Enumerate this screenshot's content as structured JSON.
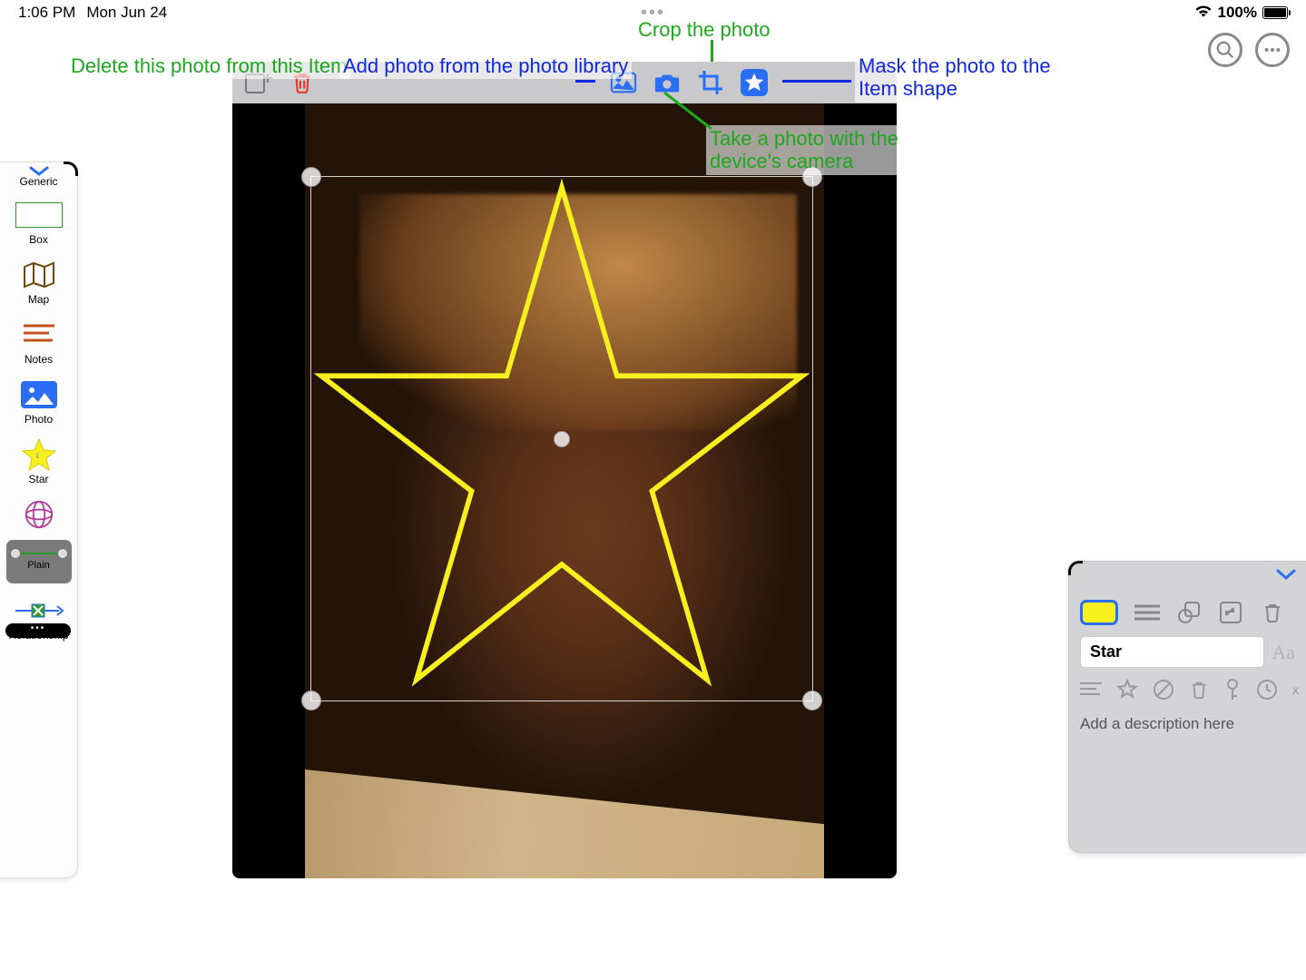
{
  "status": {
    "time": "1:06 PM",
    "date": "Mon Jun 24",
    "battery": "100%"
  },
  "annotations": {
    "delete": "Delete this photo from this Item",
    "add_library": "Add photo from the photo library",
    "crop": "Crop the photo",
    "take_photo": "Take a photo with the device's camera",
    "mask": "Mask the photo to the Item shape"
  },
  "left_panel": {
    "header": "Generic",
    "items": [
      "Box",
      "Map",
      "Notes",
      "Photo",
      "Star"
    ],
    "plain": "Plain",
    "relationship": "Relationship"
  },
  "right_panel": {
    "name": "Star",
    "description_placeholder": "Add a description here"
  }
}
